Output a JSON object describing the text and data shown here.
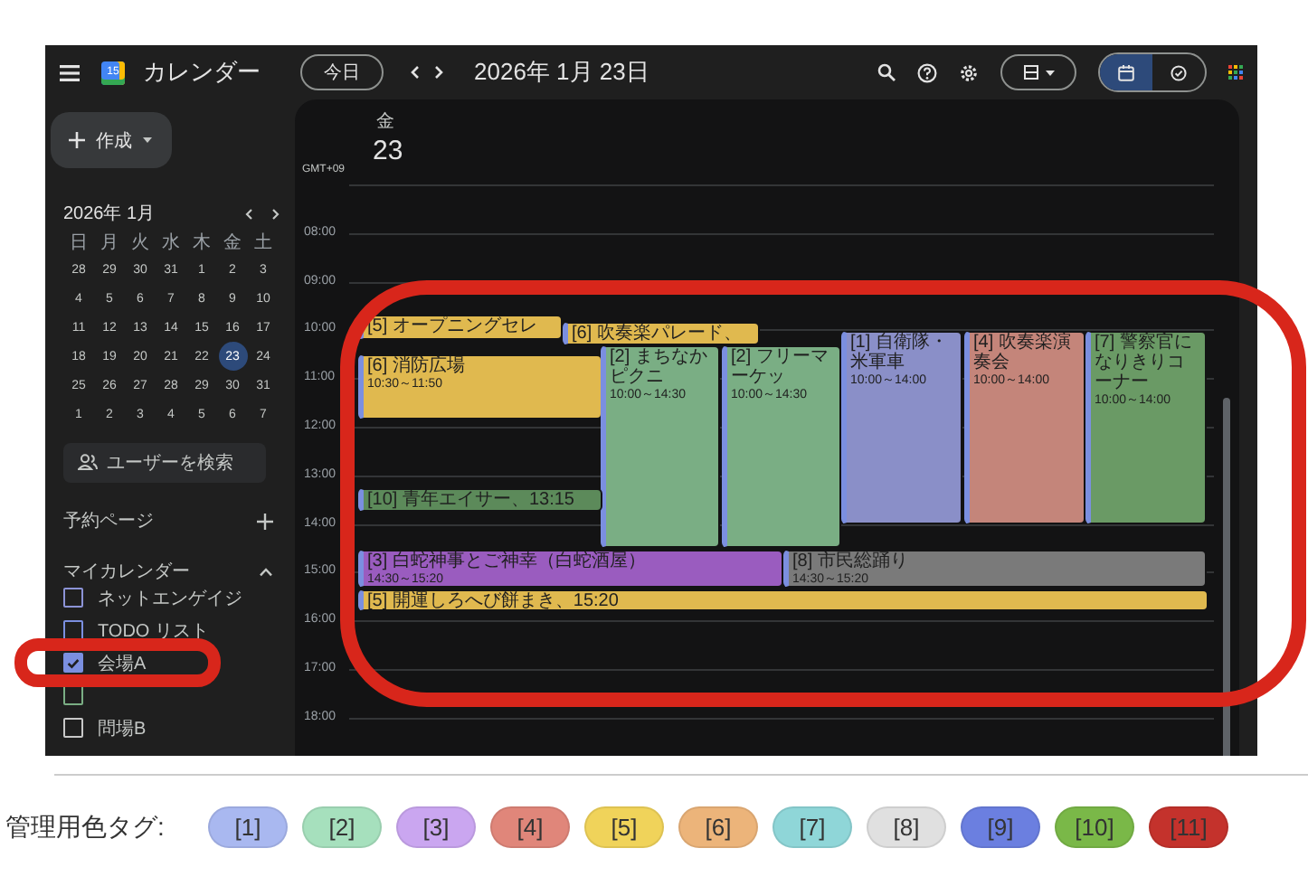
{
  "app": {
    "logo_badge": "15",
    "title": "カレンダー"
  },
  "toolbar": {
    "today_button": "今日",
    "date_title": "2026年 1月 23日",
    "view_toggle": [
      {
        "kind": "calendar",
        "selected": true
      },
      {
        "kind": "tasks",
        "selected": false
      }
    ]
  },
  "sidebar": {
    "create_button": "作成",
    "mini_calendar": {
      "title": "2026年 1月",
      "weekdays": [
        "日",
        "月",
        "火",
        "水",
        "木",
        "金",
        "土"
      ],
      "weeks": [
        [
          {
            "day": "28",
            "selected": false
          },
          {
            "day": "29",
            "selected": false
          },
          {
            "day": "30",
            "selected": false
          },
          {
            "day": "31",
            "selected": false
          },
          {
            "day": "1",
            "selected": false
          },
          {
            "day": "2",
            "selected": false
          },
          {
            "day": "3",
            "selected": false
          }
        ],
        [
          {
            "day": "4",
            "selected": false
          },
          {
            "day": "5",
            "selected": false
          },
          {
            "day": "6",
            "selected": false
          },
          {
            "day": "7",
            "selected": false
          },
          {
            "day": "8",
            "selected": false
          },
          {
            "day": "9",
            "selected": false
          },
          {
            "day": "10",
            "selected": false
          }
        ],
        [
          {
            "day": "11",
            "selected": false
          },
          {
            "day": "12",
            "selected": false
          },
          {
            "day": "13",
            "selected": false
          },
          {
            "day": "14",
            "selected": false
          },
          {
            "day": "15",
            "selected": false
          },
          {
            "day": "16",
            "selected": false
          },
          {
            "day": "17",
            "selected": false
          }
        ],
        [
          {
            "day": "18",
            "selected": false
          },
          {
            "day": "19",
            "selected": false
          },
          {
            "day": "20",
            "selected": false
          },
          {
            "day": "21",
            "selected": false
          },
          {
            "day": "22",
            "selected": false
          },
          {
            "day": "23",
            "selected": true
          },
          {
            "day": "24",
            "selected": false
          }
        ],
        [
          {
            "day": "25",
            "selected": false
          },
          {
            "day": "26",
            "selected": false
          },
          {
            "day": "27",
            "selected": false
          },
          {
            "day": "28",
            "selected": false
          },
          {
            "day": "29",
            "selected": false
          },
          {
            "day": "30",
            "selected": false
          },
          {
            "day": "31",
            "selected": false
          }
        ],
        [
          {
            "day": "1",
            "selected": false
          },
          {
            "day": "2",
            "selected": false
          },
          {
            "day": "3",
            "selected": false
          },
          {
            "day": "4",
            "selected": false
          },
          {
            "day": "5",
            "selected": false
          },
          {
            "day": "6",
            "selected": false
          },
          {
            "day": "7",
            "selected": false
          }
        ]
      ]
    },
    "people_search": {
      "placeholder": "ユーザーを検索"
    },
    "booking_pages": "予約ページ",
    "my_calendars": {
      "title": "マイカレンダー",
      "expanded": true,
      "items": [
        {
          "label": "ネットエンゲイジ",
          "color": "#8c93d6",
          "checked": false
        },
        {
          "label": "TODO リスト",
          "color": "#7b8fe0",
          "checked": false
        },
        {
          "label": "会場A",
          "color": "#7b8fe0",
          "checked": true
        },
        {
          "color": "#7aae84",
          "checked": false
        },
        {
          "label": "問場B",
          "color": "#c8c8c8",
          "checked": false
        }
      ]
    }
  },
  "day_view": {
    "weekday": "金",
    "date": "23",
    "timezone": "GMT+09",
    "hours": [
      "08:00",
      "09:00",
      "10:00",
      "11:00",
      "12:00",
      "13:00",
      "14:00",
      "15:00",
      "16:00",
      "17:00",
      "18:00"
    ],
    "events": [
      {
        "title": "[5] オープニングセレ",
        "color": "#e0b94f"
      },
      {
        "title": "[6] 吹奏楽パレード、",
        "color": "#e0b94f"
      },
      {
        "title": "[6] 消防広場",
        "time": "10:30～11:50",
        "color": "#e0b94f"
      },
      {
        "title": "[2] まちなかピクニ",
        "time": "10:00～14:30",
        "color": "#7aae84"
      },
      {
        "title": "[2] フリーマーケッ",
        "time": "10:00～14:30",
        "color": "#7aae84"
      },
      {
        "title": "[1] 自衛隊・米軍車",
        "time": "10:00～14:00",
        "color": "#8a8fc8"
      },
      {
        "title": "[4] 吹奏楽演奏会",
        "time": "10:00～14:00",
        "color": "#c4857a"
      },
      {
        "title": "[7] 警察官になりきりコーナー",
        "time": "10:00～14:00",
        "color": "#6a9a65"
      },
      {
        "title": "[10] 青年エイサー、13:15",
        "color": "#5c8a5a"
      },
      {
        "title": "[3] 白蛇神事とご神幸（白蛇酒屋）",
        "time": "14:30～15:20",
        "color": "#9a5cbf"
      },
      {
        "title": "[8] 市民総踊り",
        "time": "14:30～15:20",
        "color": "#7a7a7a"
      },
      {
        "title": "[5] 開運しろへび餅まき、15:20",
        "color": "#e0b94f"
      }
    ]
  },
  "legend": {
    "label": "管理用色タグ:",
    "tags": [
      {
        "label": "[1]",
        "color": "#a9b8f0"
      },
      {
        "label": "[2]",
        "color": "#a6e0bd"
      },
      {
        "label": "[3]",
        "color": "#caa6f0"
      },
      {
        "label": "[4]",
        "color": "#e0867a"
      },
      {
        "label": "[5]",
        "color": "#f0d35a"
      },
      {
        "label": "[6]",
        "color": "#ecb47a"
      },
      {
        "label": "[7]",
        "color": "#8fd6d8"
      },
      {
        "label": "[8]",
        "color": "#e0e0e0"
      },
      {
        "label": "[9]",
        "color": "#6b7fe0"
      },
      {
        "label": "[10]",
        "color": "#7ab848"
      },
      {
        "label": "[11]",
        "color": "#c4322c"
      }
    ]
  }
}
